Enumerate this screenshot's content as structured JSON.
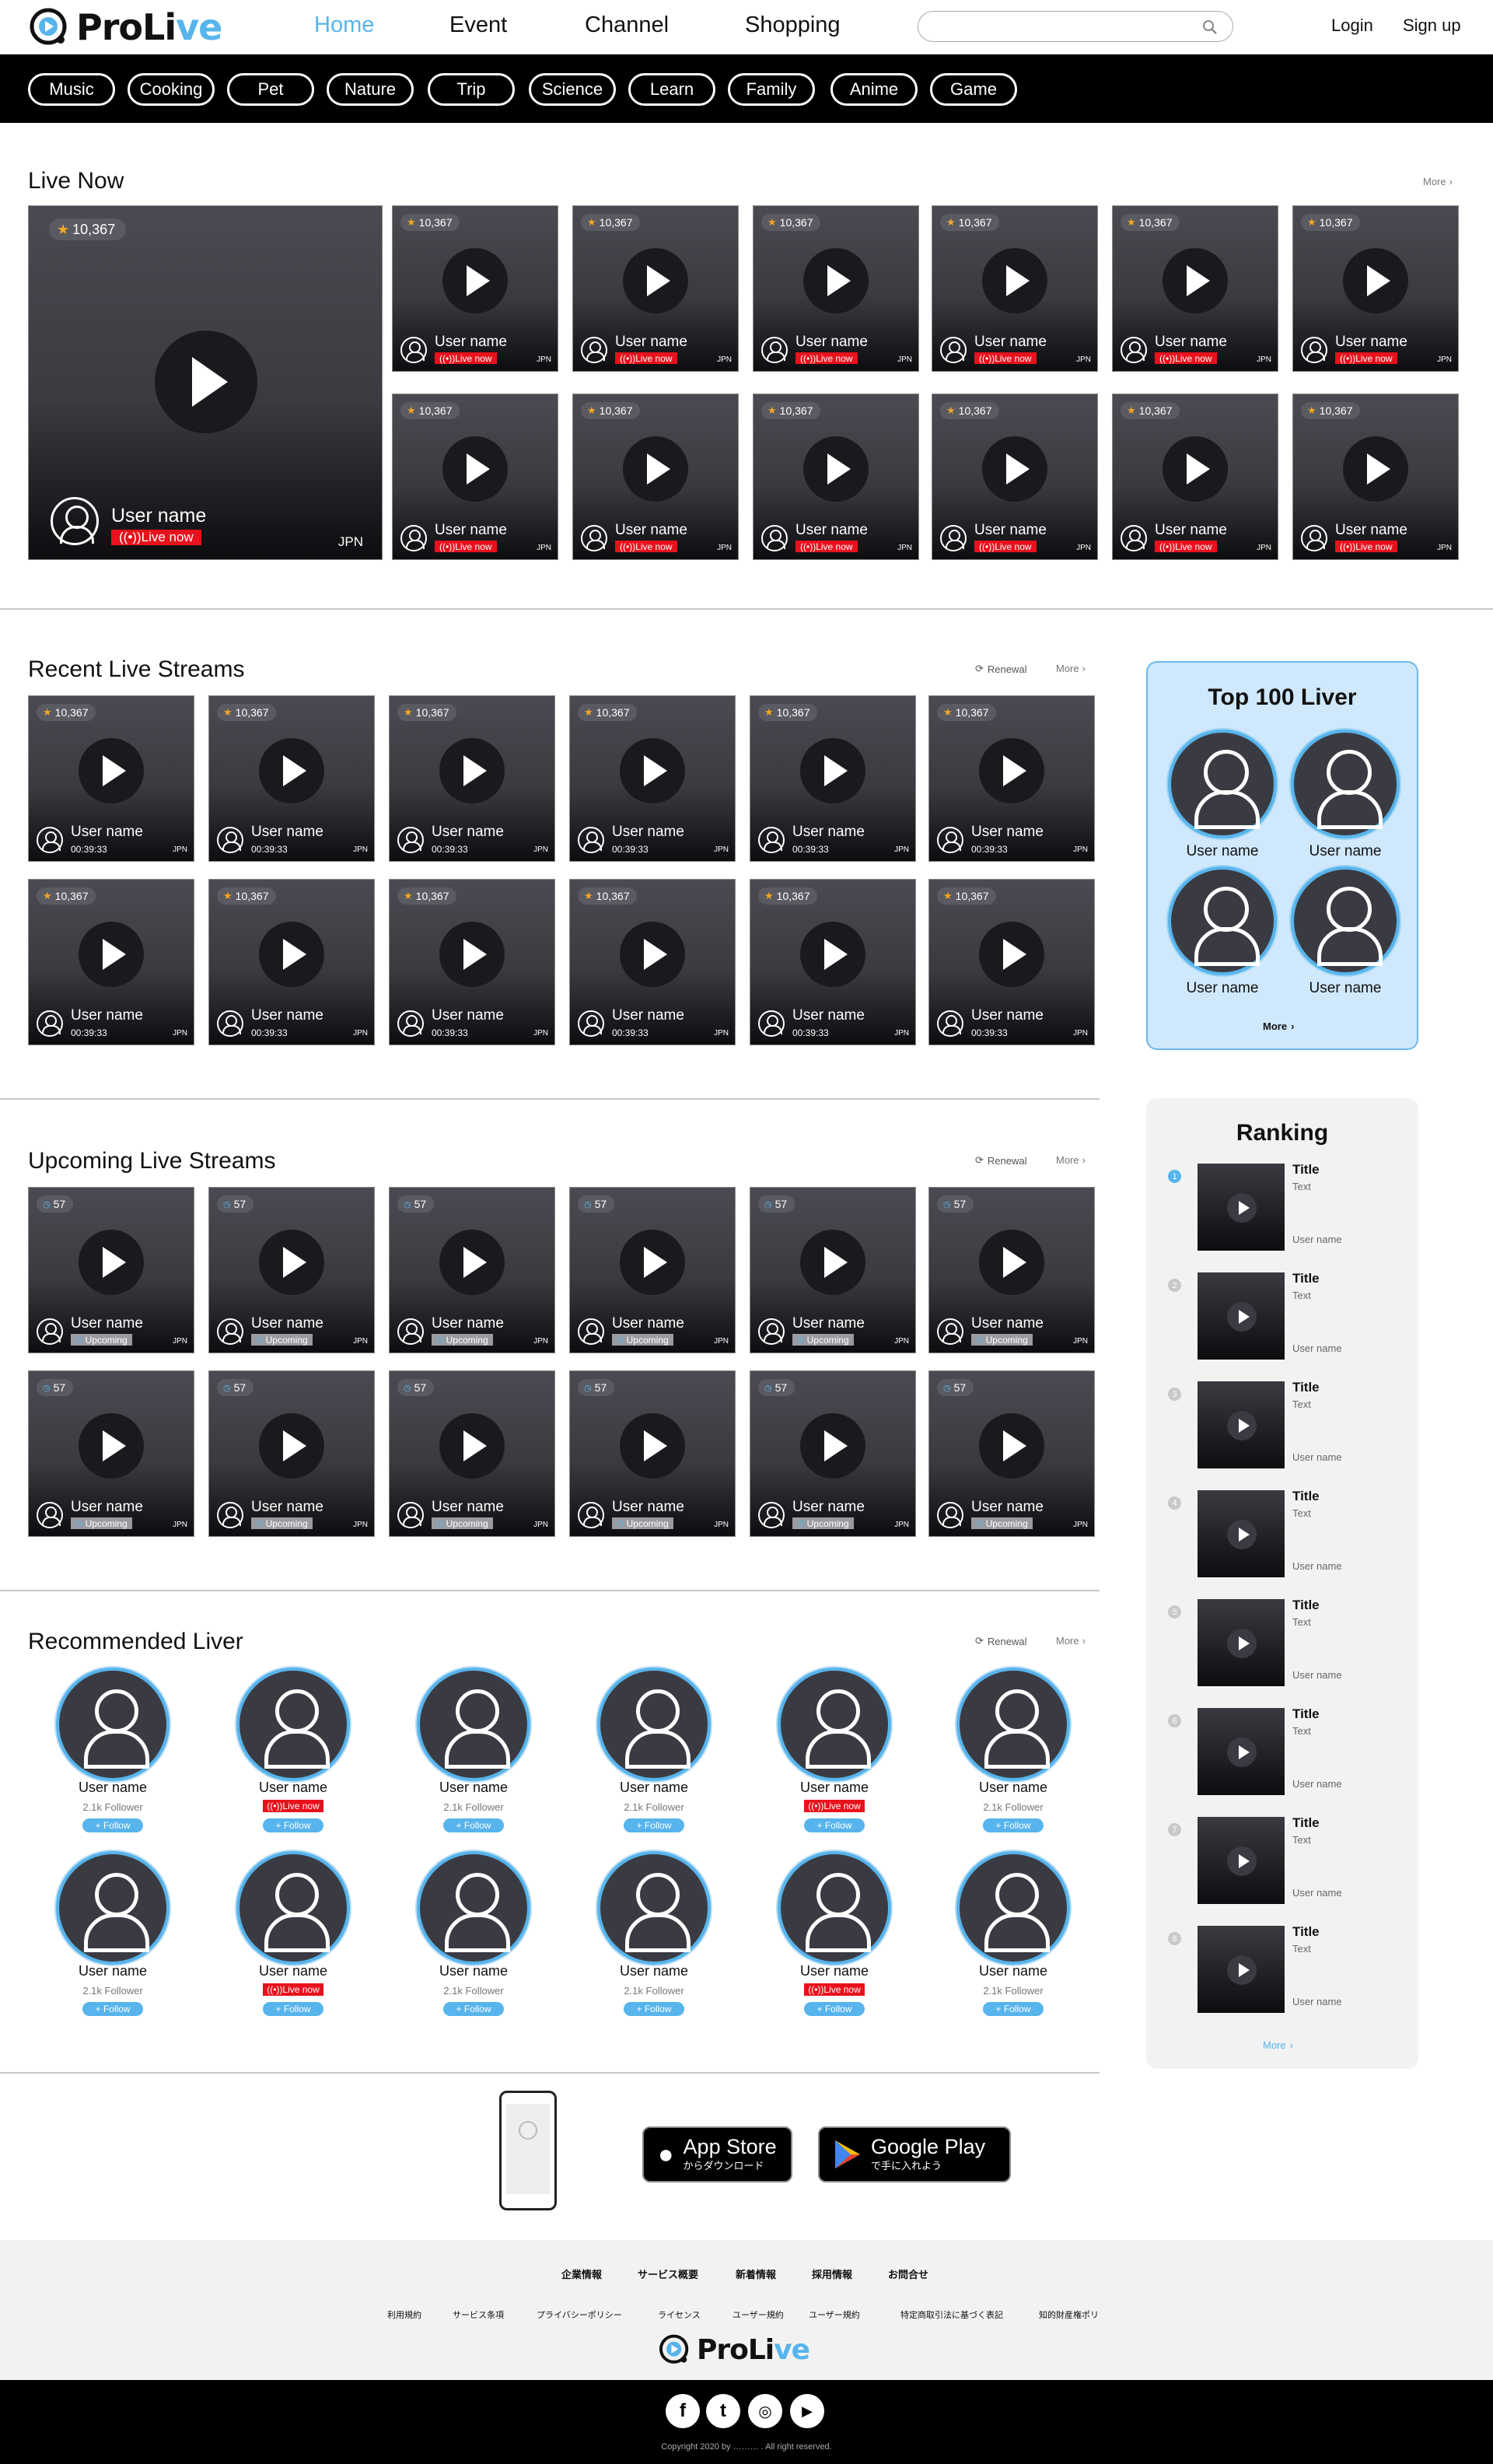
{
  "header": {
    "logo": {
      "pro": "ProLi",
      "live": "ve"
    },
    "nav": [
      {
        "label": "Home",
        "active": true
      },
      {
        "label": "Event"
      },
      {
        "label": "Channel"
      },
      {
        "label": "Shopping"
      }
    ],
    "search_placeholder": "",
    "login": "Login",
    "signup": "Sign up",
    "accent_color": "#57b4ec"
  },
  "categories": [
    "Music",
    "Cooking",
    "Pet",
    "Nature",
    "Trip",
    "Science",
    "Learn",
    "Family",
    "Anime",
    "Game"
  ],
  "live_now": {
    "title": "Live Now",
    "more": "More",
    "featured": {
      "views": "10,367",
      "user": "User name",
      "status": "Live now",
      "country": "JPN"
    },
    "cards": {
      "views": "10,367",
      "user": "User name",
      "status": "Live now",
      "country": "JPN",
      "count": 12
    }
  },
  "recent": {
    "title": "Recent Live Streams",
    "renewal": "Renewal",
    "more": "More",
    "card": {
      "views": "10,367",
      "user": "User name",
      "duration": "00:39:33",
      "country": "JPN",
      "count": 12
    }
  },
  "upcoming": {
    "title": "Upcoming Live Streams",
    "renewal": "Renewal",
    "more": "More",
    "card": {
      "views": "57",
      "user": "User name",
      "status": "Upcoming",
      "country": "JPN",
      "count": 12
    }
  },
  "recommended": {
    "title": "Recommended Liver",
    "renewal": "Renewal",
    "more": "More",
    "followers": "2.1k",
    "follower_label": "Follower",
    "follow": "+ Follow",
    "live_label": "Live now",
    "user": "User name",
    "live_flags": [
      false,
      true,
      false,
      false,
      true,
      false,
      false,
      true,
      false,
      false,
      true,
      false
    ]
  },
  "top100": {
    "title": "Top 100 Liver",
    "users": [
      "User name",
      "User name",
      "User name",
      "User name"
    ],
    "more": "More"
  },
  "ranking": {
    "title": "Ranking",
    "items": [
      {
        "rank": "1",
        "title": "Title",
        "text": "Text",
        "user": "User name"
      },
      {
        "rank": "2",
        "title": "Title",
        "text": "Text",
        "user": "User name"
      },
      {
        "rank": "3",
        "title": "Title",
        "text": "Text",
        "user": "User name"
      },
      {
        "rank": "4",
        "title": "Title",
        "text": "Text",
        "user": "User name"
      },
      {
        "rank": "5",
        "title": "Title",
        "text": "Text",
        "user": "User name"
      },
      {
        "rank": "6",
        "title": "Title",
        "text": "Text",
        "user": "User name"
      },
      {
        "rank": "7",
        "title": "Title",
        "text": "Text",
        "user": "User name"
      },
      {
        "rank": "8",
        "title": "Title",
        "text": "Text",
        "user": "User name"
      }
    ],
    "more": "More"
  },
  "app": {
    "appstore_big": "App Store",
    "appstore_small": "からダウンロード",
    "google_big": "Google Play",
    "google_small": "で手に入れよう"
  },
  "footer": {
    "links1": [
      "企業情報",
      "サービス概要",
      "新着情報",
      "採用情報",
      "お問合せ"
    ],
    "links2": [
      "利用規約",
      "サービス条項",
      "プライバシーポリシー",
      "ライセンス",
      "ユーザー規約",
      "ユーザー規約",
      "特定商取引法に基づく表記",
      "知的財産権ポリ"
    ],
    "copyright": "Copyright  2020  by ………  . All right reserved."
  }
}
